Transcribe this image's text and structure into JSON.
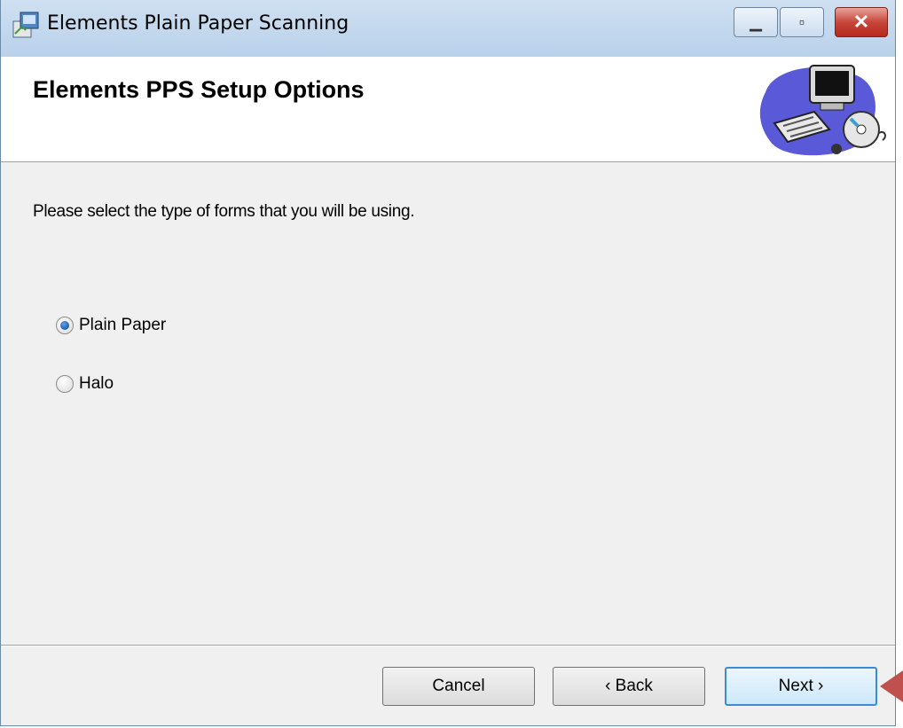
{
  "window": {
    "title": "Elements Plain Paper Scanning",
    "minimize_glyph": "▁",
    "maximize_glyph": "▫",
    "close_glyph": "✕"
  },
  "header": {
    "title": "Elements PPS Setup Options",
    "graphic": "computer-cd-clipart"
  },
  "body": {
    "instruction": "Please select the type of forms that you will be using.",
    "options": [
      {
        "label": "Plain Paper",
        "selected": true
      },
      {
        "label": "Halo",
        "selected": false
      }
    ]
  },
  "footer": {
    "cancel_label": "Cancel",
    "back_label": "‹ Back",
    "next_label": "Next ›"
  },
  "colors": {
    "accent": "#3c8bd6",
    "close": "#c7463a",
    "pointer": "#c0504d"
  }
}
